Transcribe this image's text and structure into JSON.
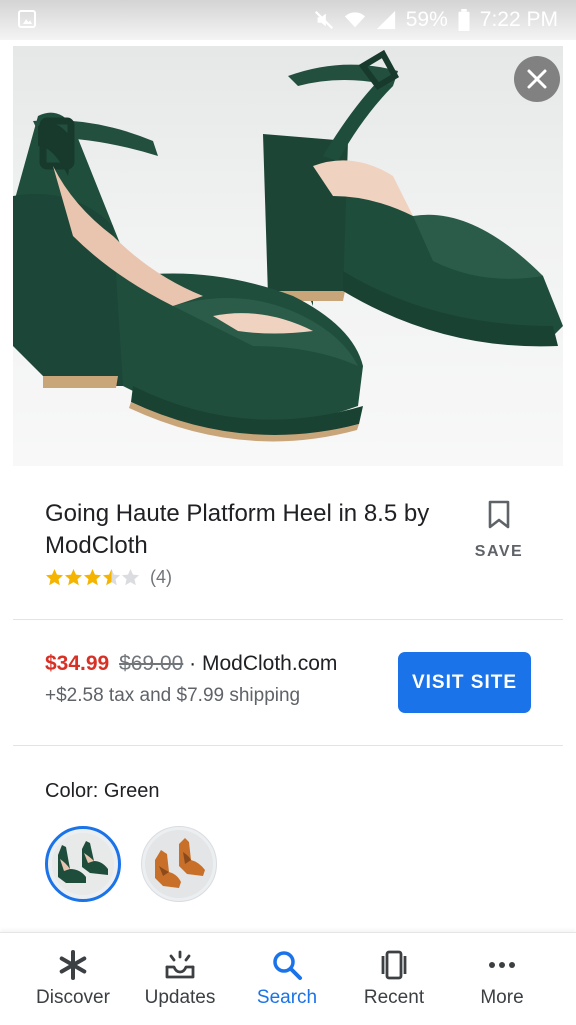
{
  "status_bar": {
    "battery": "59%",
    "time": "7:22 PM"
  },
  "product": {
    "title": "Going Haute Platform Heel in 8.5 by ModCloth",
    "rating": 3.5,
    "rating_max": 5,
    "review_count": "(4)",
    "save_label": "SAVE"
  },
  "offer": {
    "price": "$34.99",
    "original_price": "$69.00",
    "separator": " · ",
    "seller": "ModCloth.com",
    "shipping": "+$2.58 tax and $7.99 shipping",
    "visit_label": "VISIT SITE"
  },
  "color": {
    "label": "Color:",
    "value": "Green"
  },
  "nav": {
    "items": [
      {
        "label": "Discover",
        "icon": "asterisk-icon"
      },
      {
        "label": "Updates",
        "icon": "updates-icon"
      },
      {
        "label": "Search",
        "icon": "search-icon"
      },
      {
        "label": "Recent",
        "icon": "recent-icon"
      },
      {
        "label": "More",
        "icon": "more-icon"
      }
    ],
    "active_index": 2
  },
  "colors": {
    "accent": "#1a73e8",
    "sale_price": "#d93025",
    "star": "#f4b400",
    "shoe_green": "#1e4a3a",
    "shoe_orange": "#c8702a"
  }
}
